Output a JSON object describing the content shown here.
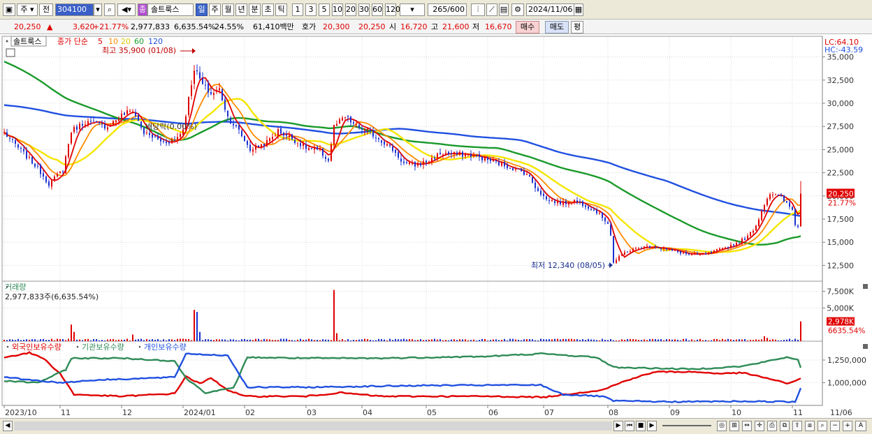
{
  "toolbar": {
    "period_jin": "주",
    "jeon": "전",
    "code": "304100",
    "stock_badge": "종",
    "stock_name": "솔트룩스",
    "periods": [
      "일",
      "주",
      "월",
      "년",
      "분",
      "초",
      "틱"
    ],
    "intervals": [
      "1",
      "3",
      "5",
      "10",
      "20",
      "30",
      "60",
      "120"
    ],
    "count": "265",
    "count_total": "/600",
    "date": "2024/11/06"
  },
  "quote": {
    "price": "20,250",
    "arrow": "▲",
    "change": "3,620",
    "change_pct": "+21.77%",
    "volume": "2,977,833",
    "volume_pct": "6,635.54%",
    "turnover": "24.55%",
    "amount": "61,410백만",
    "ask_label": "호가",
    "ask1": "20,300",
    "ask2": "20,250",
    "open_label": "시",
    "open": "16,720",
    "high_label": "고",
    "high": "21,600",
    "low_label": "저",
    "low": "16,670",
    "buy": "매수",
    "sell": "매도",
    "eval": "평"
  },
  "colors": {
    "up": "#e00000",
    "down": "#1a2fd0",
    "ma5": "#e00000",
    "ma10": "#ff8c00",
    "ma20": "#f5e600",
    "ma60": "#1a9a2a",
    "ma120": "#2050e0",
    "foreign": "#e00000",
    "inst": "#2e8b57",
    "retail": "#2050e0"
  },
  "chart_data": [
    {
      "type": "candlestick",
      "name_tag": "솔트룩스",
      "legend_title": "종가 단순",
      "legend": [
        "5",
        "10",
        "20",
        "60",
        "120"
      ],
      "lc": "LC:64.10",
      "hc": "HC:-43.59",
      "annotation_high": "최고 35,900 (01/08)",
      "annotation_low": "최저 12,340 (08/05)",
      "annotation_dividend": "배당락(0.00%)",
      "y_ticks": [
        "35,000",
        "32,500",
        "30,000",
        "27,500",
        "25,000",
        "22,500",
        "20,000",
        "17,500",
        "15,000",
        "12,500"
      ],
      "y_tick_values": [
        35000,
        32500,
        30000,
        27500,
        25000,
        22500,
        20000,
        17500,
        15000,
        12500
      ],
      "ylim": [
        10800,
        36700
      ],
      "last_price_label": "20,250",
      "last_pct_label": "21.77%",
      "close_keypoints": [
        [
          "2023-10-04",
          26800
        ],
        [
          "2023-10-20",
          23000
        ],
        [
          "2023-10-26",
          21300
        ],
        [
          "2023-11-02",
          22800
        ],
        [
          "2023-11-07",
          27000
        ],
        [
          "2023-11-14",
          28000
        ],
        [
          "2023-11-24",
          27500
        ],
        [
          "2023-12-01",
          28700
        ],
        [
          "2023-12-07",
          29300
        ],
        [
          "2023-12-13",
          26800
        ],
        [
          "2023-12-22",
          25800
        ],
        [
          "2023-12-28",
          26000
        ],
        [
          "2024-01-02",
          27200
        ],
        [
          "2024-01-08",
          33800
        ],
        [
          "2024-01-11",
          32000
        ],
        [
          "2024-01-16",
          31000
        ],
        [
          "2024-01-19",
          31500
        ],
        [
          "2024-01-24",
          28500
        ],
        [
          "2024-01-30",
          27000
        ],
        [
          "2024-02-05",
          25000
        ],
        [
          "2024-02-13",
          25800
        ],
        [
          "2024-02-19",
          27000
        ],
        [
          "2024-02-26",
          26200
        ],
        [
          "2024-03-04",
          25200
        ],
        [
          "2024-03-11",
          24800
        ],
        [
          "2024-03-14",
          23800
        ],
        [
          "2024-03-18",
          27500
        ],
        [
          "2024-03-22",
          28500
        ],
        [
          "2024-03-28",
          27500
        ],
        [
          "2024-04-03",
          27000
        ],
        [
          "2024-04-10",
          26000
        ],
        [
          "2024-04-16",
          25000
        ],
        [
          "2024-04-22",
          23500
        ],
        [
          "2024-04-26",
          23300
        ],
        [
          "2024-05-03",
          23800
        ],
        [
          "2024-05-09",
          24600
        ],
        [
          "2024-05-17",
          24500
        ],
        [
          "2024-05-24",
          24400
        ],
        [
          "2024-05-31",
          24000
        ],
        [
          "2024-06-07",
          23500
        ],
        [
          "2024-06-14",
          23000
        ],
        [
          "2024-06-21",
          22400
        ],
        [
          "2024-06-26",
          21000
        ],
        [
          "2024-07-02",
          19600
        ],
        [
          "2024-07-10",
          19200
        ],
        [
          "2024-07-16",
          19500
        ],
        [
          "2024-07-22",
          19000
        ],
        [
          "2024-07-26",
          18300
        ],
        [
          "2024-08-01",
          17100
        ],
        [
          "2024-08-02",
          15800
        ],
        [
          "2024-08-05",
          12800
        ],
        [
          "2024-08-09",
          13900
        ],
        [
          "2024-08-16",
          14400
        ],
        [
          "2024-08-23",
          14600
        ],
        [
          "2024-08-30",
          14200
        ],
        [
          "2024-09-06",
          13900
        ],
        [
          "2024-09-12",
          13600
        ],
        [
          "2024-09-20",
          13800
        ],
        [
          "2024-09-27",
          14300
        ],
        [
          "2024-10-04",
          14900
        ],
        [
          "2024-10-10",
          15600
        ],
        [
          "2024-10-15",
          16800
        ],
        [
          "2024-10-18",
          19200
        ],
        [
          "2024-10-22",
          20300
        ],
        [
          "2024-10-28",
          19800
        ],
        [
          "2024-11-01",
          18500
        ],
        [
          "2024-11-04",
          17000
        ],
        [
          "2024-11-05",
          16630
        ],
        [
          "2024-11-06",
          20250
        ]
      ],
      "last_candle": {
        "date": "2024-11-06",
        "open": 16720,
        "high": 21600,
        "low": 16670,
        "close": 20250
      }
    },
    {
      "type": "bar",
      "title": "거래량",
      "value_label": "2,977,833주(6,635.54%)",
      "y_ticks": [
        "7,500K",
        "5,000K"
      ],
      "y_tick_values": [
        7500,
        5000
      ],
      "ylim": [
        0,
        8700
      ],
      "unit": "K shares",
      "last_label": "2,978K",
      "last_pct": "6635.54%",
      "spikes": [
        [
          "2023-11-07",
          2500
        ],
        [
          "2023-11-08",
          1400
        ],
        [
          "2023-12-07",
          1000
        ],
        [
          "2024-01-08",
          4700
        ],
        [
          "2024-01-09",
          4400
        ],
        [
          "2024-01-10",
          1400
        ],
        [
          "2024-03-18",
          7700
        ],
        [
          "2024-03-19",
          1200
        ],
        [
          "2024-10-18",
          750
        ],
        [
          "2024-10-21",
          500
        ],
        [
          "2024-11-06",
          2978
        ]
      ],
      "base_volume": 250
    },
    {
      "type": "line",
      "legend": [
        "외국인보유수량",
        "기관보유수량",
        "개인보유수량"
      ],
      "y_ticks": [
        "1,250,000",
        "1,000,000"
      ],
      "y_tick_values": [
        1250000,
        1000000
      ],
      "ylim": [
        750000,
        1450000
      ],
      "series": [
        {
          "name": "외국인보유수량",
          "keypoints": [
            [
              "2023-10-04",
              1280000
            ],
            [
              "2023-10-17",
              1330000
            ],
            [
              "2023-10-24",
              1270000
            ],
            [
              "2023-11-01",
              1100000
            ],
            [
              "2023-11-08",
              870000
            ],
            [
              "2023-12-01",
              850000
            ],
            [
              "2023-12-28",
              880000
            ],
            [
              "2024-01-03",
              1070000
            ],
            [
              "2024-01-10",
              990000
            ],
            [
              "2024-01-16",
              1050000
            ],
            [
              "2024-01-24",
              920000
            ],
            [
              "2024-02-01",
              850000
            ],
            [
              "2024-03-04",
              850000
            ],
            [
              "2024-03-20",
              890000
            ],
            [
              "2024-04-10",
              850000
            ],
            [
              "2024-06-03",
              850000
            ],
            [
              "2024-07-01",
              840000
            ],
            [
              "2024-07-15",
              880000
            ],
            [
              "2024-07-30",
              920000
            ],
            [
              "2024-08-12",
              1030000
            ],
            [
              "2024-08-26",
              1120000
            ],
            [
              "2024-09-12",
              1120000
            ],
            [
              "2024-09-27",
              1100000
            ],
            [
              "2024-10-08",
              1110000
            ],
            [
              "2024-10-21",
              1050000
            ],
            [
              "2024-10-30",
              990000
            ],
            [
              "2024-11-06",
              1045000
            ]
          ]
        },
        {
          "name": "기관보유수량",
          "keypoints": [
            [
              "2023-10-04",
              1020000
            ],
            [
              "2023-10-20",
              1000000
            ],
            [
              "2023-11-03",
              1140000
            ],
            [
              "2023-11-07",
              1270000
            ],
            [
              "2023-12-01",
              1270000
            ],
            [
              "2023-12-28",
              1240000
            ],
            [
              "2024-01-03",
              1050000
            ],
            [
              "2024-01-12",
              890000
            ],
            [
              "2024-01-26",
              940000
            ],
            [
              "2024-02-02",
              1280000
            ],
            [
              "2024-03-04",
              1270000
            ],
            [
              "2024-04-10",
              1270000
            ],
            [
              "2024-06-03",
              1290000
            ],
            [
              "2024-06-28",
              1320000
            ],
            [
              "2024-07-26",
              1280000
            ],
            [
              "2024-08-05",
              1170000
            ],
            [
              "2024-09-12",
              1150000
            ],
            [
              "2024-10-08",
              1180000
            ],
            [
              "2024-10-30",
              1280000
            ],
            [
              "2024-11-05",
              1260000
            ],
            [
              "2024-11-06",
              1160000
            ]
          ]
        },
        {
          "name": "개인보유수량",
          "keypoints": [
            [
              "2023-10-04",
              1060000
            ],
            [
              "2023-11-01",
              1000000
            ],
            [
              "2023-11-20",
              1030000
            ],
            [
              "2023-12-28",
              1060000
            ],
            [
              "2024-01-03",
              1320000
            ],
            [
              "2024-01-24",
              1300000
            ],
            [
              "2024-02-02",
              950000
            ],
            [
              "2024-03-04",
              950000
            ],
            [
              "2024-05-02",
              970000
            ],
            [
              "2024-06-28",
              975000
            ],
            [
              "2024-07-10",
              870000
            ],
            [
              "2024-07-30",
              850000
            ],
            [
              "2024-08-05",
              800000
            ],
            [
              "2024-09-02",
              790000
            ],
            [
              "2024-10-08",
              795000
            ],
            [
              "2024-11-04",
              790000
            ],
            [
              "2024-11-06",
              940000
            ]
          ]
        }
      ]
    }
  ],
  "x_axis": {
    "labels": [
      [
        "2023-10-04",
        "2023/10"
      ],
      [
        "2023-11-01",
        "11"
      ],
      [
        "2023-12-01",
        "12"
      ],
      [
        "2024-01-02",
        "2024/01"
      ],
      [
        "2024-02-01",
        "02"
      ],
      [
        "2024-03-04",
        "03"
      ],
      [
        "2024-04-01",
        "04"
      ],
      [
        "2024-05-02",
        "05"
      ],
      [
        "2024-06-03",
        "06"
      ],
      [
        "2024-07-01",
        "07"
      ],
      [
        "2024-08-01",
        "08"
      ],
      [
        "2024-09-02",
        "09"
      ],
      [
        "2024-10-02",
        "10"
      ],
      [
        "2024-11-01",
        "11"
      ],
      [
        "2024-11-06",
        "11/06"
      ]
    ],
    "first_date": "2023-10-04",
    "last_date": "2024-11-06"
  }
}
